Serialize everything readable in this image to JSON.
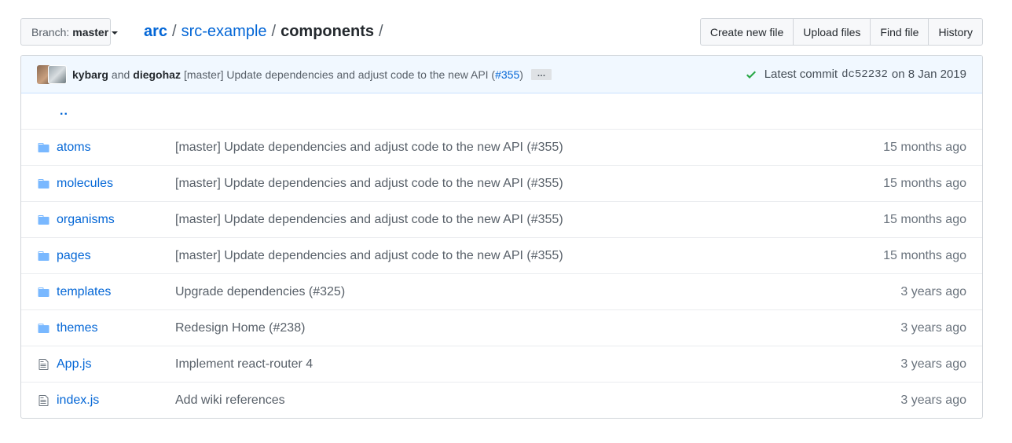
{
  "branch": {
    "prefix": "Branch:",
    "name": "master"
  },
  "breadcrumb": {
    "root": "arc",
    "sep": "/",
    "part1": "src-example",
    "current": "components"
  },
  "actions": {
    "create": "Create new file",
    "upload": "Upload files",
    "find": "Find file",
    "history": "History"
  },
  "commit": {
    "author1": "kybarg",
    "and": "and",
    "author2": "diegohaz",
    "message": "[master] Update dependencies and adjust code to the new API (",
    "pr": "#355",
    "message_end": ")",
    "ellipsis": "…",
    "latest_label": "Latest commit",
    "sha": "dc52232",
    "date": "on 8 Jan 2019"
  },
  "up_link": "..",
  "files": [
    {
      "type": "dir",
      "icon": "folder-icon",
      "name": "atoms",
      "message": "[master] Update dependencies and adjust code to the new API (#355)",
      "age": "15 months ago"
    },
    {
      "type": "dir",
      "icon": "folder-icon",
      "name": "molecules",
      "message": "[master] Update dependencies and adjust code to the new API (#355)",
      "age": "15 months ago"
    },
    {
      "type": "dir",
      "icon": "folder-icon",
      "name": "organisms",
      "message": "[master] Update dependencies and adjust code to the new API (#355)",
      "age": "15 months ago"
    },
    {
      "type": "dir",
      "icon": "folder-icon",
      "name": "pages",
      "message": "[master] Update dependencies and adjust code to the new API (#355)",
      "age": "15 months ago"
    },
    {
      "type": "dir",
      "icon": "folder-icon",
      "name": "templates",
      "message": "Upgrade dependencies (#325)",
      "age": "3 years ago"
    },
    {
      "type": "dir",
      "icon": "folder-icon",
      "name": "themes",
      "message": "Redesign Home (#238)",
      "age": "3 years ago"
    },
    {
      "type": "file",
      "icon": "file-icon",
      "name": "App.js",
      "message": "Implement react-router 4",
      "age": "3 years ago"
    },
    {
      "type": "file",
      "icon": "file-icon",
      "name": "index.js",
      "message": "Add wiki references",
      "age": "3 years ago"
    }
  ],
  "colors": {
    "link": "#0366d6",
    "success": "#28a745",
    "commit_bg": "#f1f8ff",
    "folder": "#79b8ff"
  }
}
